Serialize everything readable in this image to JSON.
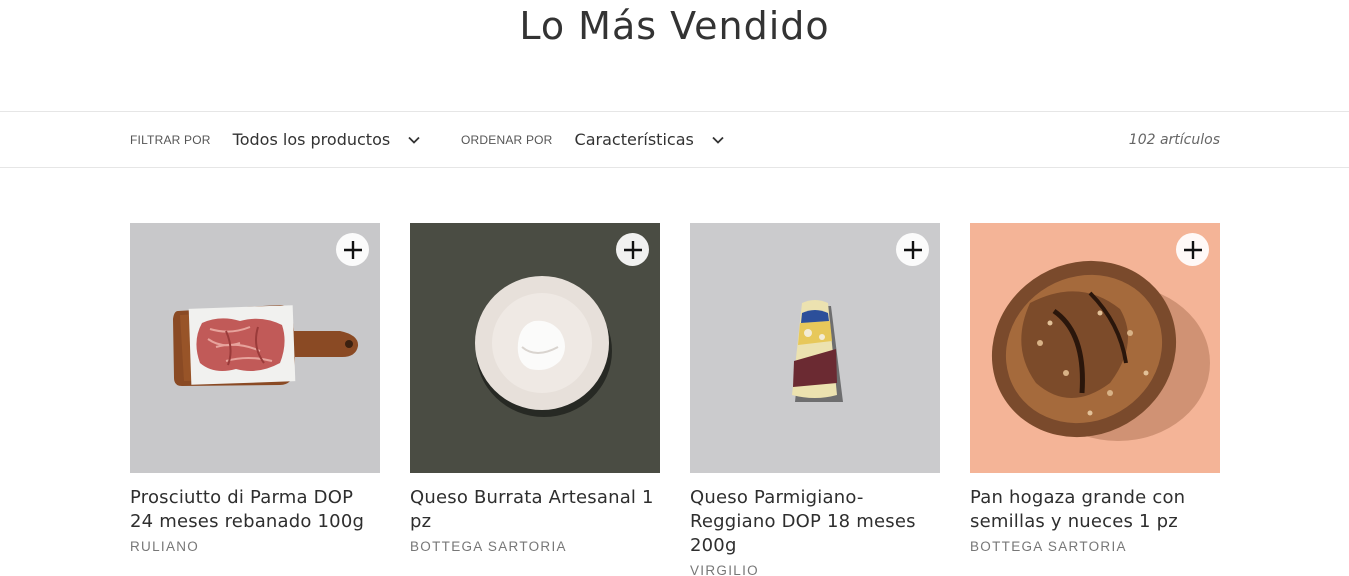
{
  "page": {
    "title": "Lo Más Vendido"
  },
  "filters": {
    "filter_label": "FILTRAR POR",
    "filter_value": "Todos los productos",
    "sort_label": "ORDENAR POR",
    "sort_value": "Características",
    "count": "102 artículos"
  },
  "products": [
    {
      "title": "Prosciutto di Parma DOP 24 meses rebanado 100g",
      "vendor": "RULIANO",
      "bg": "#c8c8ca"
    },
    {
      "title": "Queso Burrata Artesanal 1 pz",
      "vendor": "BOTTEGA SARTORIA",
      "bg": "#4a4c43"
    },
    {
      "title": "Queso Parmigiano-Reggiano DOP 18 meses 200g",
      "vendor": "VIRGILIO",
      "bg": "#cbcbcd"
    },
    {
      "title": "Pan hogaza grande con semillas y nueces 1 pz",
      "vendor": "BOTTEGA SARTORIA",
      "bg": "#f4b497"
    }
  ],
  "icons": {
    "add": "plus-icon",
    "dropdown": "chevron-down-icon"
  }
}
